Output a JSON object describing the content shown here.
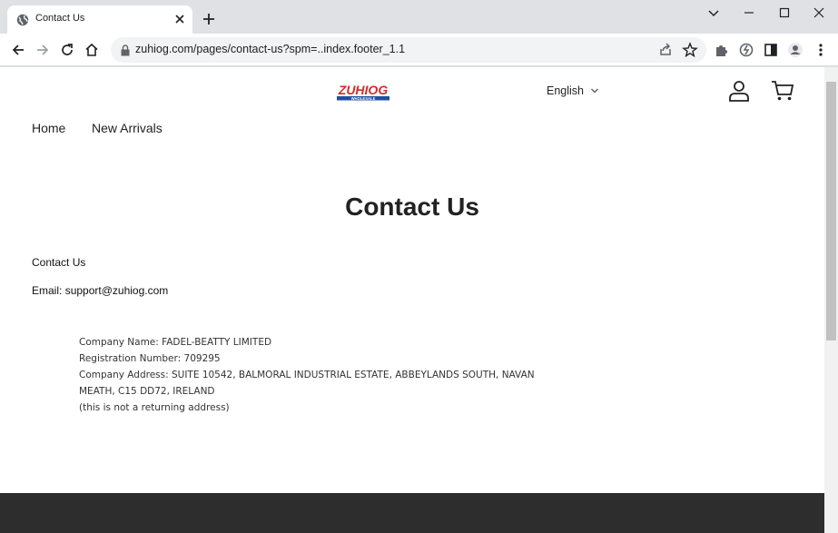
{
  "browser": {
    "tab": {
      "title": "Contact Us",
      "favicon": "globe-icon"
    },
    "url": "zuhiog.com/pages/contact-us?spm=..index.footer_1.1",
    "icons": [
      "back-icon",
      "forward-icon",
      "reload-icon",
      "home-icon",
      "lock-icon",
      "share-icon",
      "star-icon",
      "extensions-icon",
      "sync-icon",
      "side-panel-icon",
      "profile-icon",
      "menu-icon",
      "minimize-icon",
      "maximize-icon",
      "close-icon",
      "chevron-down-icon",
      "new-tab-icon"
    ]
  },
  "header": {
    "logo_text": "ZUHIOG",
    "logo_sub": "WHOLESALE",
    "language": "English"
  },
  "nav": {
    "items": [
      "Home",
      "New Arrivals"
    ]
  },
  "main": {
    "title": "Contact Us",
    "sub_heading": "Contact Us",
    "email_label": "Email:",
    "email_value": "support@zuhiog.com",
    "company_lines": [
      "Company Name: FADEL-BEATTY LIMITED",
      "Registration Number: 709295",
      "Company Address: SUITE 10542, BALMORAL INDUSTRIAL ESTATE, ABBEYLANDS SOUTH, NAVAN",
      "MEATH, C15 DD72, IRELAND",
      "(this is not a returning address)"
    ]
  },
  "colors": {
    "logo_red": "#d62b26",
    "logo_blue": "#1e4fa0",
    "footer_bg": "#2d2d2d"
  }
}
